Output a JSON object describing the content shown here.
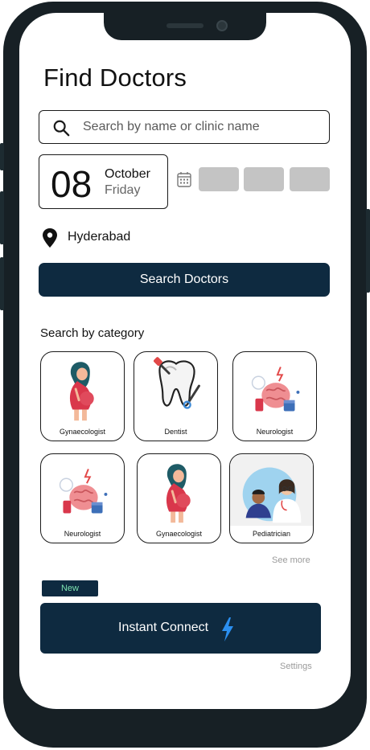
{
  "page": {
    "title": "Find Doctors"
  },
  "search": {
    "placeholder": "Search by name or clinic name"
  },
  "date": {
    "day": "08",
    "month": "October",
    "weekday": "Friday"
  },
  "location": {
    "city": "Hyderabad"
  },
  "actions": {
    "search_doctors": "Search Doctors",
    "see_more": "See more",
    "new_badge": "New",
    "instant_connect": "Instant Connect",
    "settings": "Settings"
  },
  "categories": {
    "heading": "Search by category",
    "items": [
      {
        "label": "Gynaecologist",
        "icon": "pregnant-woman-icon"
      },
      {
        "label": "Dentist",
        "icon": "tooth-icon"
      },
      {
        "label": "Neurologist",
        "icon": "brain-icon"
      },
      {
        "label": "Neurologist",
        "icon": "brain-icon"
      },
      {
        "label": "Gynaecologist",
        "icon": "pregnant-woman-icon"
      },
      {
        "label": "Pediatrician",
        "icon": "doctor-child-icon"
      }
    ]
  },
  "colors": {
    "primary": "#0e2a40",
    "badge_text": "#7de3b0",
    "slot_gray": "#c4c4c4",
    "muted_text": "#9a9a9a",
    "bolt_blue": "#2b8ff0"
  }
}
